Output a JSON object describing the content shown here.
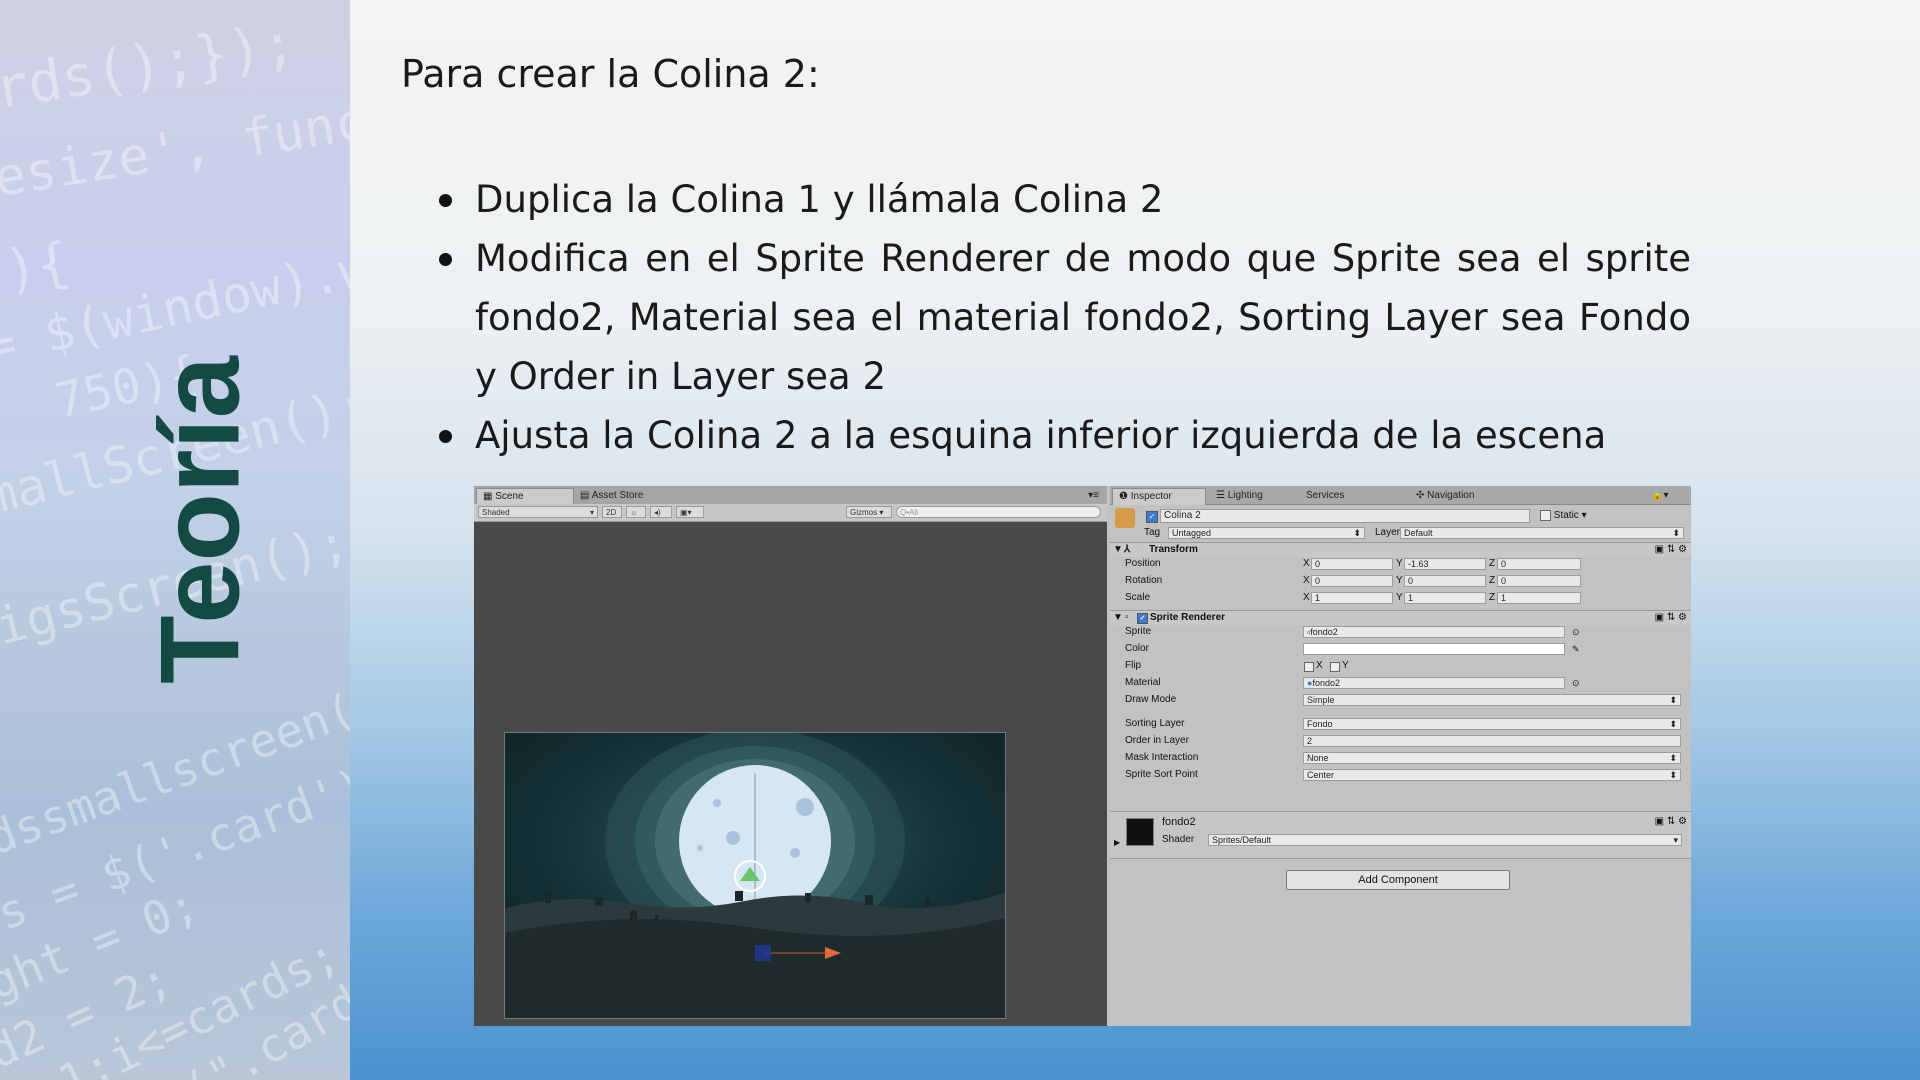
{
  "sidebar": {
    "title": "Teoría",
    "code_lines": [
      "rds();});",
      "esize', functi",
      "){",
      "= $(window).wid",
      "750){",
      "mallScreen();",
      "igsScreen();",
      "dssmallscreen()",
      "s = $('.card').",
      "ght = 0;",
      "d2 = 2;",
      "= 1;i<=cards;",
      "$(\".card\""
    ]
  },
  "slide": {
    "heading": "Para crear la Colina 2:",
    "bullets": [
      "Duplica la Colina 1 y llámala Colina 2",
      "Modifica en el Sprite Renderer de modo que Sprite sea el sprite fondo2, Material sea el material fondo2, Sorting Layer sea Fondo y Order in Layer sea 2",
      "Ajusta la Colina 2 a la esquina inferior izquierda de la escena"
    ]
  },
  "scene": {
    "tabs": [
      "Scene",
      "Asset Store"
    ],
    "shading": "Shaded",
    "mode_2d": "2D",
    "gizmos": "Gizmos",
    "search_placeholder": "Q•All"
  },
  "inspector": {
    "tabs": [
      "Inspector",
      "Lighting",
      "Services",
      "Navigation"
    ],
    "object_name": "Colina 2",
    "static_label": "Static",
    "tag_label": "Tag",
    "tag_value": "Untagged",
    "layer_label": "Layer",
    "layer_value": "Default",
    "transform": {
      "title": "Transform",
      "position_label": "Position",
      "position": {
        "x": "0",
        "y": "-1.63",
        "z": "0"
      },
      "rotation_label": "Rotation",
      "rotation": {
        "x": "0",
        "y": "0",
        "z": "0"
      },
      "scale_label": "Scale",
      "scale": {
        "x": "1",
        "y": "1",
        "z": "1"
      }
    },
    "sprite_renderer": {
      "title": "Sprite Renderer",
      "sprite_label": "Sprite",
      "sprite": "fondo2",
      "color_label": "Color",
      "flip_label": "Flip",
      "flip_x": "X",
      "flip_y": "Y",
      "material_label": "Material",
      "material": "fondo2",
      "draw_mode_label": "Draw Mode",
      "draw_mode": "Simple",
      "sorting_layer_label": "Sorting Layer",
      "sorting_layer": "Fondo",
      "order_label": "Order in Layer",
      "order": "2",
      "mask_label": "Mask Interaction",
      "mask": "None",
      "sort_point_label": "Sprite Sort Point",
      "sort_point": "Center"
    },
    "material_block": {
      "name": "fondo2",
      "shader_label": "Shader",
      "shader": "Sprites/Default"
    },
    "add_component": "Add Component"
  }
}
